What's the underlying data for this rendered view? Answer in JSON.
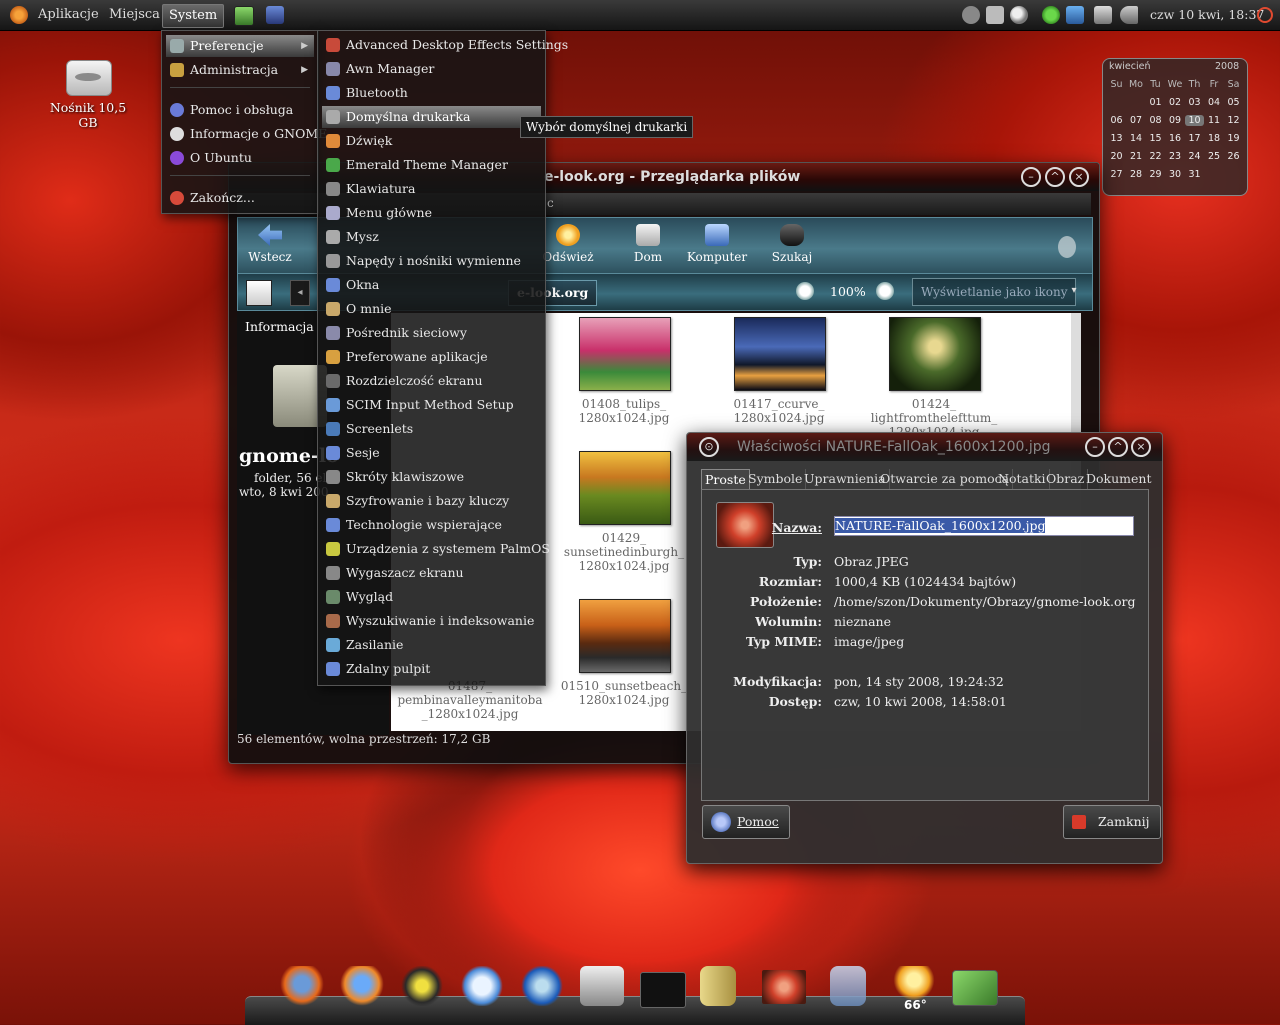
{
  "top_panel": {
    "menus": [
      "Aplikacje",
      "Miejsca",
      "System"
    ],
    "clock": "czw 10 kwi, 18:37"
  },
  "desktop": {
    "drive_label": "Nośnik 10,5 GB"
  },
  "system_menu": {
    "items": [
      "Preferencje",
      "Administracja",
      "Pomoc i obsługa",
      "Informacje o GNOME",
      "O Ubuntu",
      "Zakończ..."
    ]
  },
  "preferences_menu": {
    "items": [
      "Advanced Desktop Effects Settings",
      "Awn Manager",
      "Bluetooth",
      "Domyślna drukarka",
      "Dźwięk",
      "Emerald Theme Manager",
      "Klawiatura",
      "Menu główne",
      "Mysz",
      "Napędy i nośniki wymienne",
      "Okna",
      "O mnie",
      "Pośrednik sieciowy",
      "Preferowane aplikacje",
      "Rozdzielczość ekranu",
      "SCIM Input Method Setup",
      "Screenlets",
      "Sesje",
      "Skróty klawiszowe",
      "Szyfrowanie i bazy kluczy",
      "Technologie wspierające",
      "Urządzenia z systemem PalmOS",
      "Wygaszacz ekranu",
      "Wygląd",
      "Wyszukiwanie i indeksowanie",
      "Zasilanie",
      "Zdalny pulpit"
    ],
    "tooltip": "Wybór domyślnej drukarki"
  },
  "file_browser": {
    "title": "e-look.org - Przeglądarka plików",
    "menubar_fragment": "c",
    "toolbar": [
      "Wstecz",
      "Odśwież",
      "Dom",
      "Komputer",
      "Szukaj"
    ],
    "location_label": "e-look.org",
    "zoom": "100%",
    "view_mode": "Wyświetlanie jako ikony",
    "sidebar": {
      "title": "Informacja",
      "folder_name": "gnome-lo",
      "folder_info": "folder, 56 el",
      "folder_date": "wto, 8 kwi 200"
    },
    "files": [
      {
        "name": "01408_tulips_\n1280x1024.jpg"
      },
      {
        "name": "01417_ccurve_\n1280x1024.jpg"
      },
      {
        "name": "01424_\nlightfromthelefttum_\n1280x1024.jpg"
      },
      {
        "name": "01429_\nsunsetinedinburgh_\n1280x1024.jpg"
      },
      {
        "name": "01487_\npembinavalleymanitoba\n_1280x1024.jpg"
      },
      {
        "name": "01510_sunsetbeach_\n1280x1024.jpg"
      }
    ],
    "status": "56 elementów, wolna przestrzeń: 17,2 GB"
  },
  "properties": {
    "title": "Właściwości NATURE-FallOak_1600x1200.jpg",
    "tabs": [
      "Proste",
      "Symbole",
      "Uprawnienia",
      "Otwarcie za pomocą",
      "Notatki",
      "Obraz",
      "Dokument"
    ],
    "name_label": "Nazwa:",
    "name_value": "NATURE-FallOak_1600x1200.jpg",
    "rows": [
      {
        "label": "Typ:",
        "value": "Obraz JPEG"
      },
      {
        "label": "Rozmiar:",
        "value": "1000,4 KB (1024434 bajtów)"
      },
      {
        "label": "Położenie:",
        "value": "/home/szon/Dokumenty/Obrazy/gnome-look.org"
      },
      {
        "label": "Wolumin:",
        "value": "nieznane"
      },
      {
        "label": "Typ MIME:",
        "value": "image/jpeg"
      },
      {
        "label": "Modyfikacja:",
        "value": "pon, 14 sty 2008, 19:24:32"
      },
      {
        "label": "Dostęp:",
        "value": "czw, 10 kwi 2008, 14:58:01"
      }
    ],
    "help_button": "Pomoc",
    "close_button": "Zamknij"
  },
  "calendar": {
    "month": "kwiecień",
    "year": "2008",
    "weekdays": [
      "Su",
      "Mo",
      "Tu",
      "We",
      "Th",
      "Fr",
      "Sa"
    ],
    "weeks": [
      [
        "",
        "",
        "01",
        "02",
        "03",
        "04",
        "05"
      ],
      [
        "06",
        "07",
        "08",
        "09",
        "10",
        "11",
        "12"
      ],
      [
        "13",
        "14",
        "15",
        "16",
        "17",
        "18",
        "19"
      ],
      [
        "20",
        "21",
        "22",
        "23",
        "24",
        "25",
        "26"
      ],
      [
        "27",
        "28",
        "29",
        "30",
        "31",
        "",
        ""
      ]
    ],
    "today": "10"
  },
  "dock": {
    "weather_temp": "66°"
  }
}
